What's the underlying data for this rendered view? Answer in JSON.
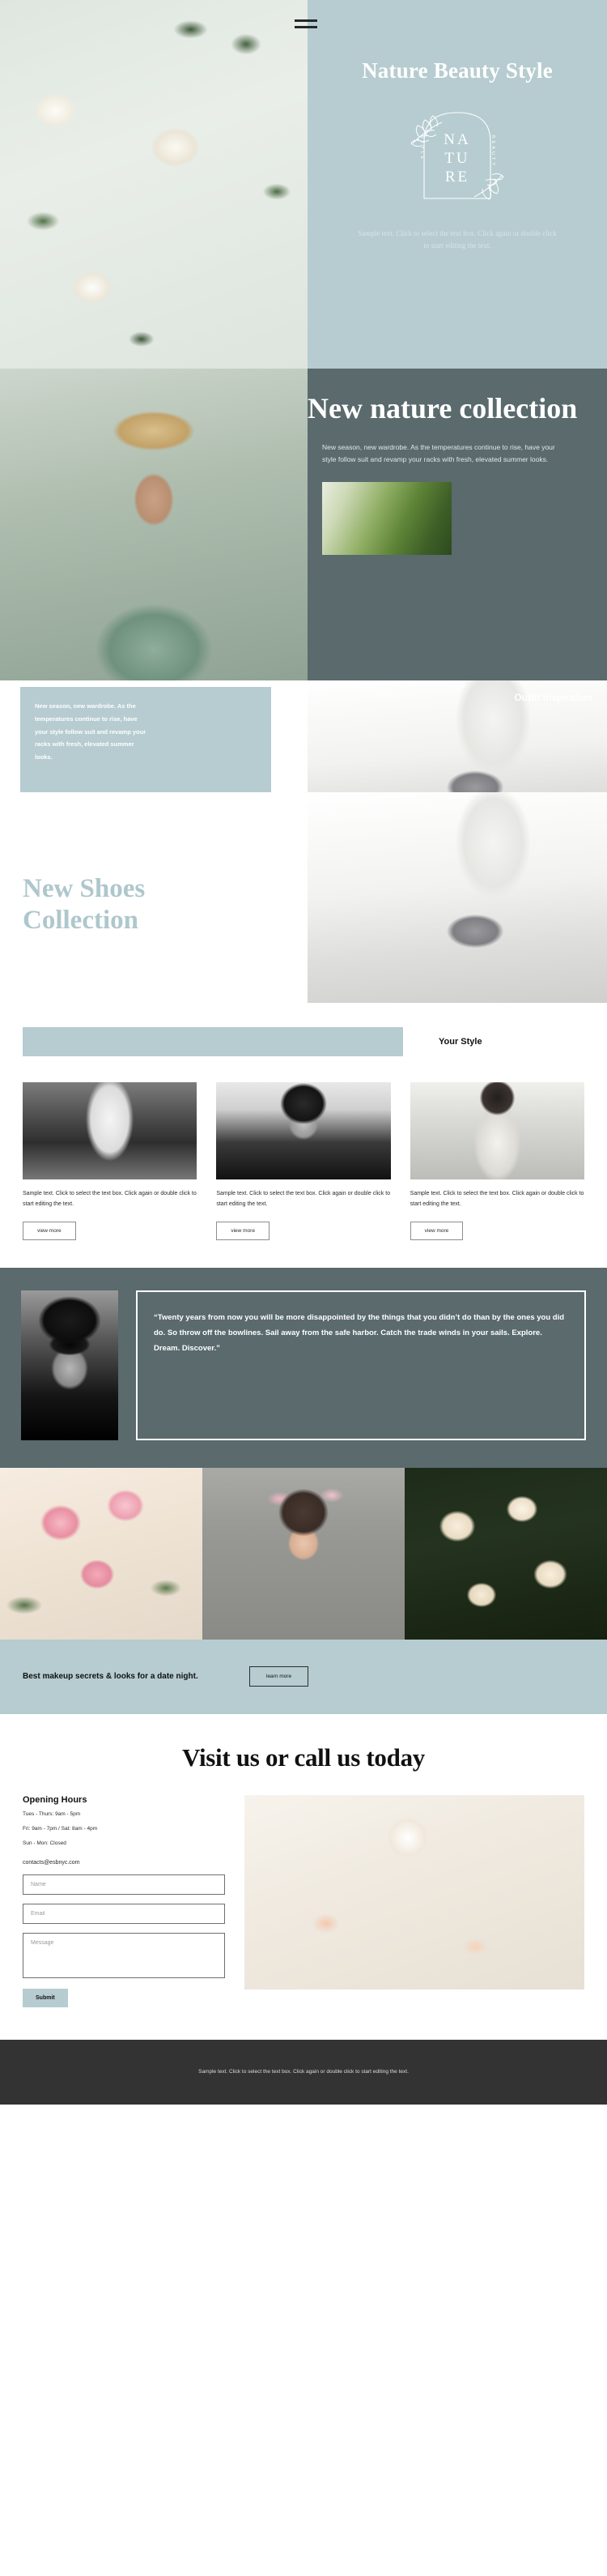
{
  "hero": {
    "menu_icon": "hamburger-icon",
    "title": "Nature Beauty Style",
    "logo": {
      "line1": "NA",
      "line2": "TU",
      "line3": "RE",
      "left_vertical": "STYLE",
      "right_vertical": "BEAUTY"
    },
    "subtitle": "Sample text. Click to select the text box. Click again or double click to start editing the text."
  },
  "nature": {
    "heading": "New nature collection",
    "paragraph": "New season, new wardrobe. As the temperatures continue to rise, have your style follow suit and revamp your racks with fresh, elevated summer looks."
  },
  "outfit": {
    "text": "New season, new wardrobe. As the temperatures continue to rise, have your style follow suit and revamp your racks with fresh, elevated summer looks.",
    "label": "Outfit Inspiration"
  },
  "shoes": {
    "heading": "New Shoes Collection"
  },
  "style": {
    "label": "Your Style",
    "cards": [
      {
        "text": "Sample text. Click to select the text box. Click again or double click to start editing the text.",
        "button": "view more"
      },
      {
        "text": "Sample text. Click to select the text box. Click again or double click to start editing the text.",
        "button": "view more"
      },
      {
        "text": "Sample text. Click to select the text box. Click again or double click to start editing the text.",
        "button": "view more"
      }
    ]
  },
  "quote": {
    "text": "“Twenty years from now you will be more disappointed by the things that you didn’t do than by the ones you did do. So throw off the bowlines. Sail away from the safe harbor. Catch the trade winds in your sails. Explore. Dream. Discover.”"
  },
  "cta": {
    "text": "Best makeup secrets & looks for a date night.",
    "button": "learn more"
  },
  "contact": {
    "heading": "Visit us or call us today",
    "hours_title": "Opening Hours",
    "hours": [
      "Tues - Thurs: 9am - 5pm",
      "Fri: 9am - 7pm / Sat: 8am - 4pm",
      "Sun - Mon: Closed"
    ],
    "email": "contacts@esbnyc.com",
    "name_placeholder": "Name",
    "email_placeholder": "Email",
    "message_placeholder": "Message",
    "submit_label": "Submit"
  },
  "footer": {
    "text": "Sample text. Click to select the text box. Click again or double click to start editing the text."
  },
  "colors": {
    "accent": "#b6ccd0",
    "slate": "#5a6a6d",
    "footer": "#333333"
  }
}
